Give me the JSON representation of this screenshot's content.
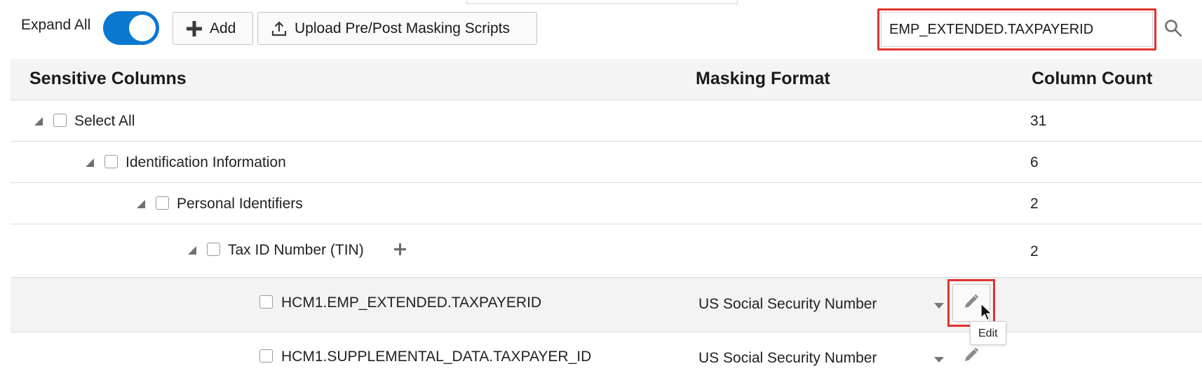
{
  "toolbar": {
    "expand_all_label": "Expand All",
    "expand_all_on": true,
    "add_label": "Add",
    "upload_label": "Upload Pre/Post Masking Scripts",
    "search_value": "EMP_EXTENDED.TAXPAYERID"
  },
  "table": {
    "headers": {
      "sensitive_columns": "Sensitive Columns",
      "masking_format": "Masking Format",
      "column_count": "Column Count"
    },
    "rows": [
      {
        "label": "Select All",
        "count": "31",
        "level": 0
      },
      {
        "label": "Identification Information",
        "count": "6",
        "level": 1
      },
      {
        "label": "Personal Identifiers",
        "count": "2",
        "level": 2
      },
      {
        "label": "Tax ID Number (TIN)",
        "count": "2",
        "level": 3
      },
      {
        "label": "HCM1.EMP_EXTENDED.TAXPAYERID",
        "format": "US Social Security Number",
        "selected": true
      },
      {
        "label": "HCM1.SUPPLEMENTAL_DATA.TAXPAYER_ID",
        "format": "US Social Security Number",
        "selected": false
      }
    ]
  },
  "tooltip": {
    "text": "Edit"
  },
  "icons": [
    "plus-icon",
    "upload-icon",
    "search-icon",
    "edit-pencil-icon",
    "mouse-cursor-icon",
    "expand-triangle-icon",
    "dropdown-caret-icon"
  ],
  "colors": {
    "accent": "#0b78d0",
    "highlight": "#e0322e"
  }
}
